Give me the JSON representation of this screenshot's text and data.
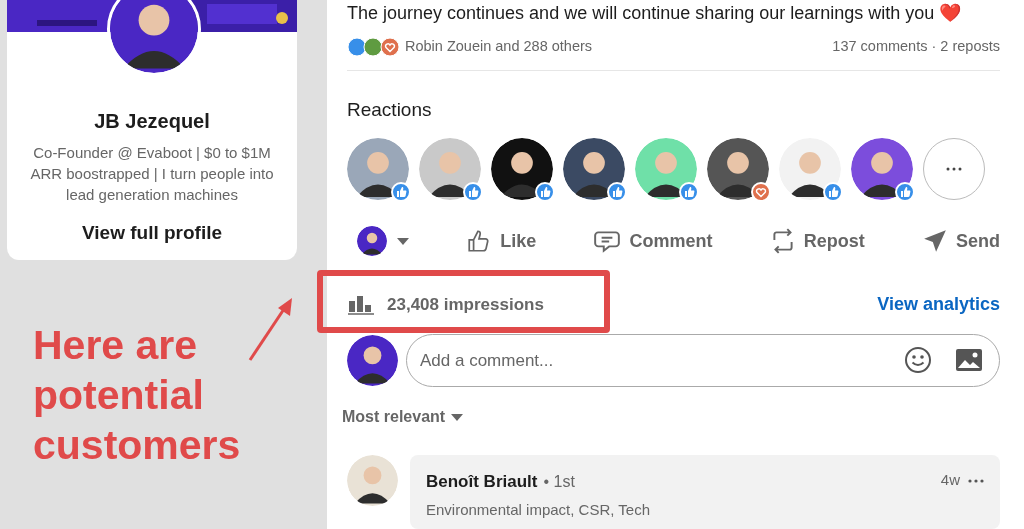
{
  "profile_card": {
    "name": "JB Jezequel",
    "headline": "Co-Founder @ Evaboot | $0 to $1M ARR boostrapped | I turn people into lead generation machines",
    "link": "View full profile"
  },
  "post": {
    "text": "The journey continues and we will continue sharing our learnings with you ❤️",
    "reactions_summary": "Robin Zouein and 288 others",
    "stats": "137 comments · 2 reposts",
    "reactions_title": "Reactions",
    "reactors": [
      {
        "kind": "like"
      },
      {
        "kind": "like"
      },
      {
        "kind": "like"
      },
      {
        "kind": "like"
      },
      {
        "kind": "like"
      },
      {
        "kind": "love"
      },
      {
        "kind": "like"
      },
      {
        "kind": "like"
      }
    ],
    "actions": [
      {
        "kind": "like",
        "label": "Like"
      },
      {
        "kind": "comment",
        "label": "Comment"
      },
      {
        "kind": "repost",
        "label": "Repost"
      },
      {
        "kind": "send",
        "label": "Send"
      }
    ],
    "impressions": "23,408 impressions",
    "analytics_link": "View analytics"
  },
  "comment_box": {
    "placeholder": "Add a comment..."
  },
  "sort": "Most relevant",
  "comments": [
    {
      "author": "Benoît Briault",
      "degree": "• 1st",
      "headline": "Environmental impact, CSR, Tech",
      "time": "4w"
    }
  ],
  "annotation": {
    "text": "Here are potential customers"
  }
}
